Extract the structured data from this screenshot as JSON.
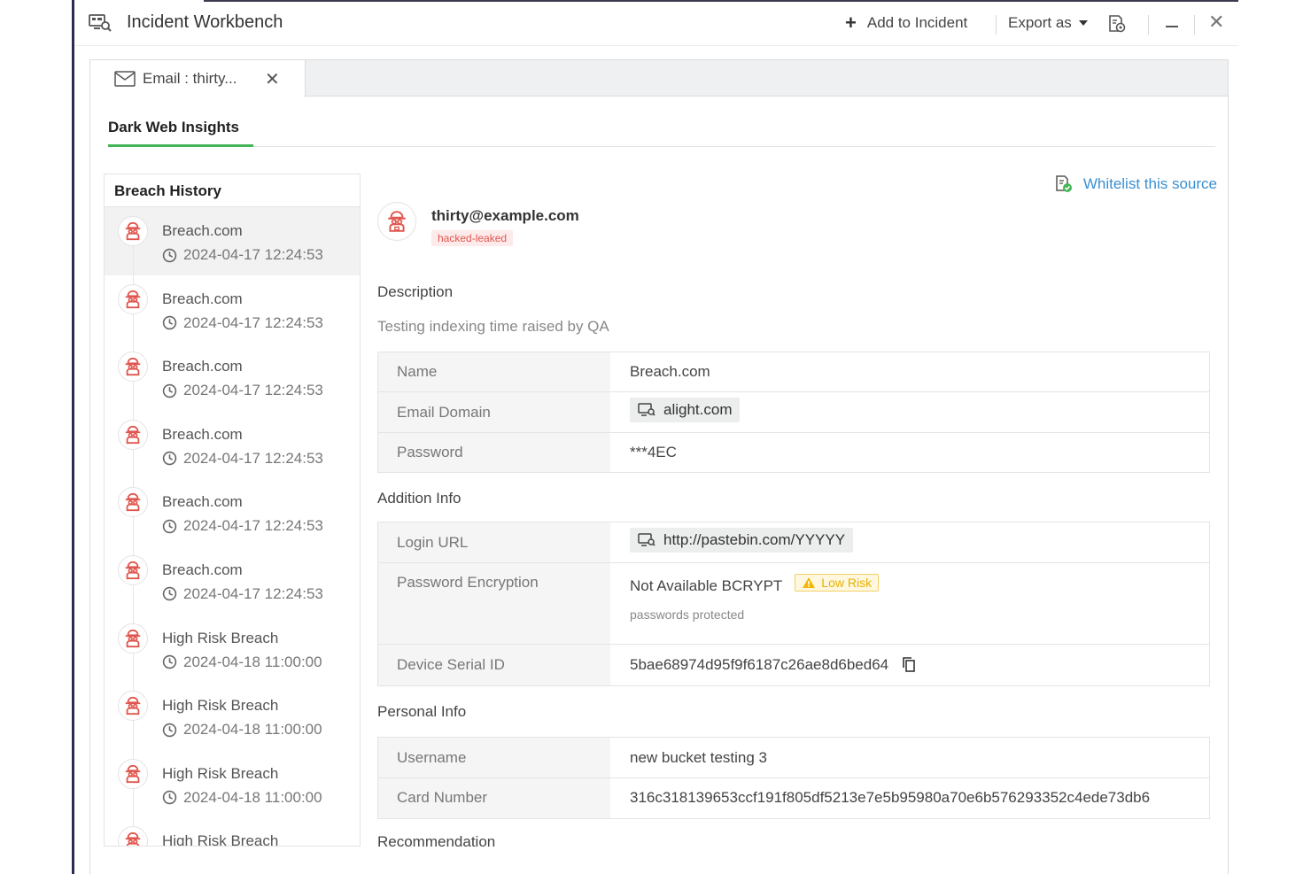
{
  "titlebar": {
    "title": "Incident Workbench",
    "add_to_incident": "Add to Incident",
    "export_as": "Export as"
  },
  "tab": {
    "label": "Email : thirty..."
  },
  "subtab": {
    "label": "Dark Web Insights"
  },
  "history": {
    "title": "Breach History",
    "items": [
      {
        "name": "Breach.com",
        "time": "2024-04-17 12:24:53",
        "active": true
      },
      {
        "name": "Breach.com",
        "time": "2024-04-17 12:24:53"
      },
      {
        "name": "Breach.com",
        "time": "2024-04-17 12:24:53"
      },
      {
        "name": "Breach.com",
        "time": "2024-04-17 12:24:53"
      },
      {
        "name": "Breach.com",
        "time": "2024-04-17 12:24:53"
      },
      {
        "name": "Breach.com",
        "time": "2024-04-17 12:24:53"
      },
      {
        "name": "High Risk Breach",
        "time": "2024-04-18 11:00:00"
      },
      {
        "name": "High Risk Breach",
        "time": "2024-04-18 11:00:00"
      },
      {
        "name": "High Risk Breach",
        "time": "2024-04-18 11:00:00"
      },
      {
        "name": "High Risk Breach",
        "time": ""
      }
    ]
  },
  "detail": {
    "whitelist": "Whitelist this source",
    "email": "thirty@example.com",
    "tag": "hacked-leaked",
    "description_title": "Description",
    "description": "Testing indexing time raised by QA",
    "main": {
      "name_label": "Name",
      "name_value": "Breach.com",
      "domain_label": "Email Domain",
      "domain_value": "alight.com",
      "password_label": "Password",
      "password_value": "***4EC"
    },
    "addition_title": "Addition Info",
    "addition": {
      "login_label": "Login URL",
      "login_value": "http://pastebin.com/YYYYY",
      "encryption_label": "Password Encryption",
      "encryption_value": "Not Available BCRYPT",
      "risk_label": "Low Risk",
      "encryption_note": "passwords protected",
      "serial_label": "Device Serial ID",
      "serial_value": "5bae68974d95f9f6187c26ae8d6bed64"
    },
    "personal_title": "Personal Info",
    "personal": {
      "username_label": "Username",
      "username_value": "new bucket testing 3",
      "card_label": "Card Number",
      "card_value": "316c318139653ccf191f805df5213e7e5b95980a70e6b576293352c4ede73db6"
    },
    "recommendation_title": "Recommendation"
  },
  "colors": {
    "accent": "#44b556",
    "link": "#3b8fd1",
    "danger": "#e0574f",
    "warning": "#e8b000"
  }
}
